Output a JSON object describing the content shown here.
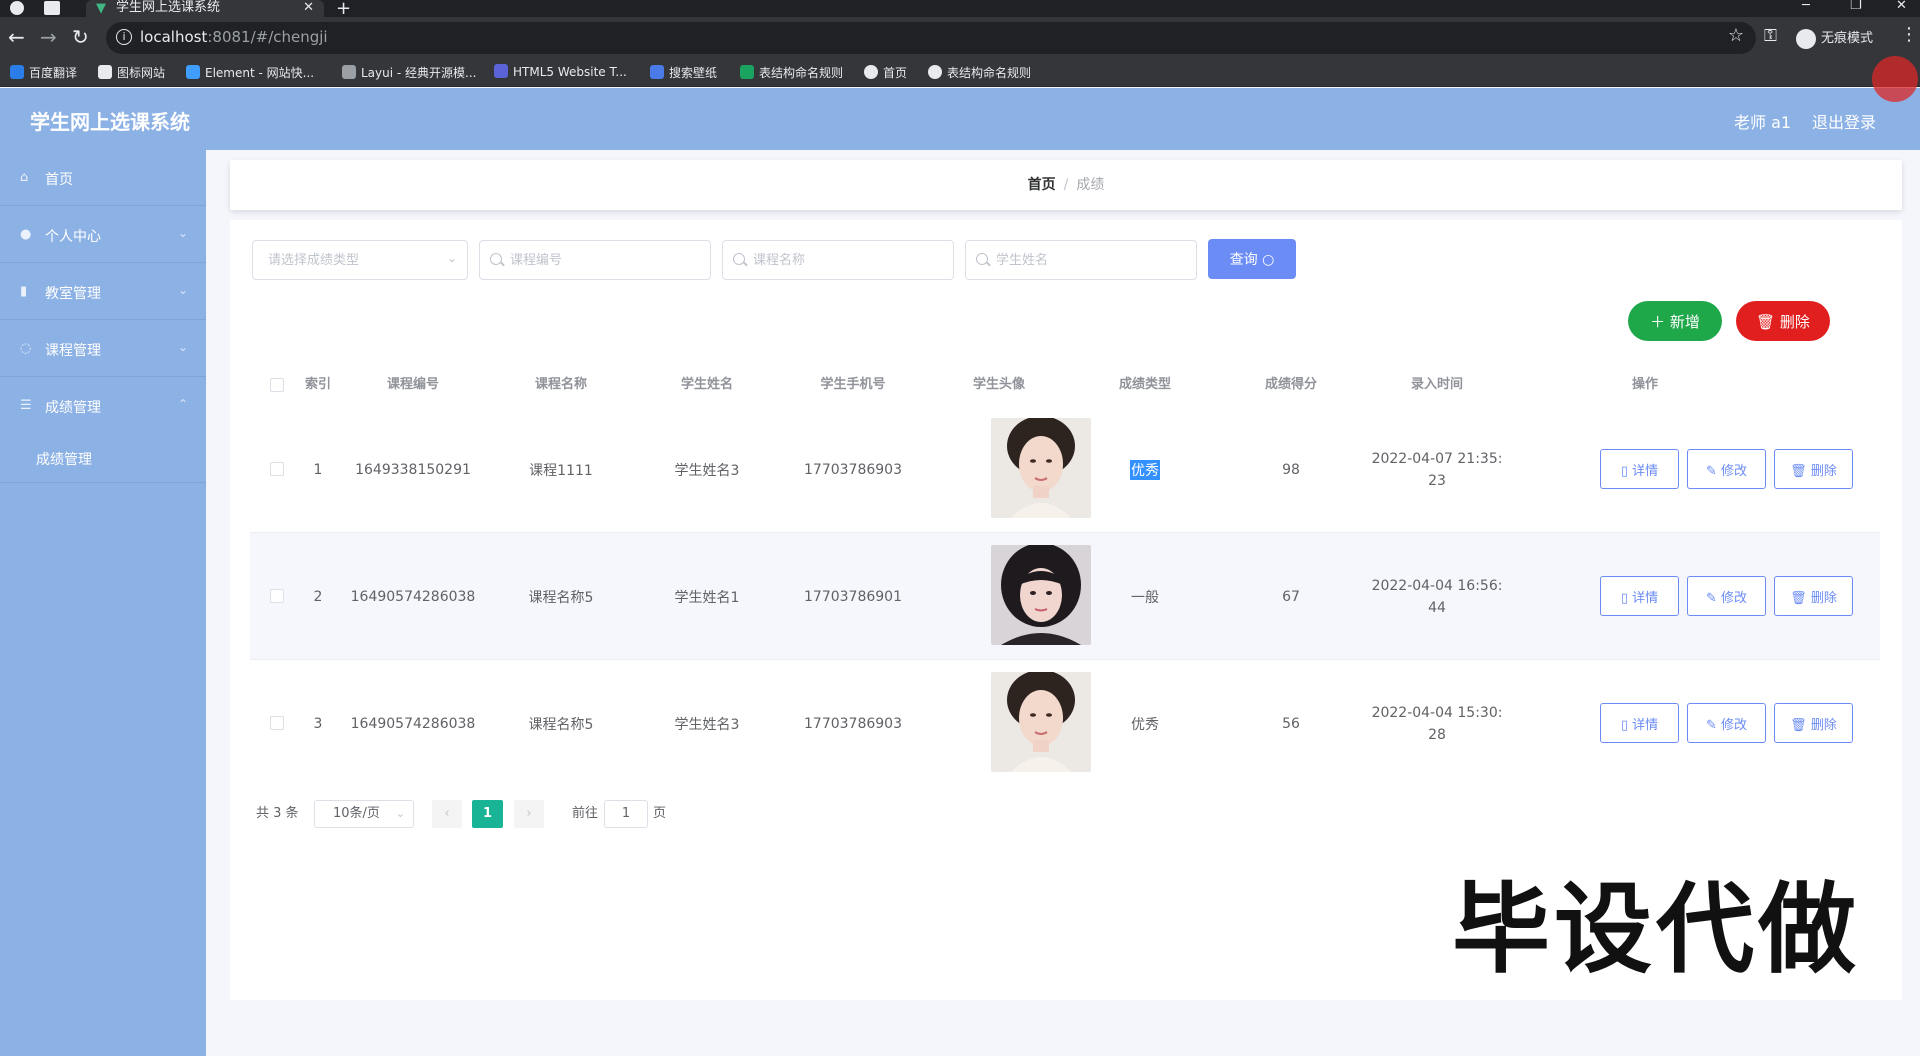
{
  "browser": {
    "tab_title": "学生网上选课系统",
    "url_host": "localhost",
    "url_rest": ":8081/#/chengji",
    "incognito_label": "无痕模式",
    "bookmarks": [
      "百度翻译",
      "图标网站",
      "Element - 网站快...",
      "Layui - 经典开源模...",
      "HTML5 Website T...",
      "搜索壁纸",
      "表结构命名规则",
      "首页",
      "表结构命名规则"
    ]
  },
  "app": {
    "title": "学生网上选课系统",
    "user_label": "老师 a1",
    "logout_label": "退出登录"
  },
  "sidebar": {
    "items": [
      {
        "label": "首页",
        "icon": "home-icon"
      },
      {
        "label": "个人中心",
        "icon": "user-icon"
      },
      {
        "label": "教室管理",
        "icon": "chart-icon"
      },
      {
        "label": "课程管理",
        "icon": "course-icon"
      },
      {
        "label": "成绩管理",
        "icon": "list-icon"
      }
    ],
    "sub_item": "成绩管理"
  },
  "breadcrumb": {
    "home": "首页",
    "sep": "/",
    "current": "成绩"
  },
  "search": {
    "type_placeholder": "请选择成绩类型",
    "course_no_placeholder": "课程编号",
    "course_name_placeholder": "课程名称",
    "student_name_placeholder": "学生姓名",
    "query_label": "查询"
  },
  "actions": {
    "add_label": "新增",
    "delete_label": "删除"
  },
  "table": {
    "headers": [
      "索引",
      "课程编号",
      "课程名称",
      "学生姓名",
      "学生手机号",
      "学生头像",
      "成绩类型",
      "成绩得分",
      "录入时间",
      "操作"
    ],
    "rows": [
      {
        "index": "1",
        "course_no": "1649338150291",
        "course_name": "课程1111",
        "student": "学生姓名3",
        "phone": "17703786903",
        "grade_type": "优秀",
        "score": "98",
        "time1": "2022-04-07 21:35:",
        "time2": "23"
      },
      {
        "index": "2",
        "course_no": "16490574286038",
        "course_name": "课程名称5",
        "student": "学生姓名1",
        "phone": "17703786901",
        "grade_type": "一般",
        "score": "67",
        "time1": "2022-04-04 16:56:",
        "time2": "44"
      },
      {
        "index": "3",
        "course_no": "16490574286038",
        "course_name": "课程名称5",
        "student": "学生姓名3",
        "phone": "17703786903",
        "grade_type": "优秀",
        "score": "56",
        "time1": "2022-04-04 15:30:",
        "time2": "28"
      }
    ],
    "op_detail": "详情",
    "op_edit": "修改",
    "op_delete": "删除"
  },
  "pagination": {
    "total": "共 3 条",
    "page_size": "10条/页",
    "current": "1",
    "goto_label": "前往",
    "goto_value": "1",
    "page_unit": "页"
  },
  "watermark": "毕设代做",
  "colors": {
    "header": "#8cb1e4",
    "primary": "#6b8cf5",
    "success": "#1fa84a",
    "danger": "#e11f1f",
    "pager_active": "#19b495"
  }
}
